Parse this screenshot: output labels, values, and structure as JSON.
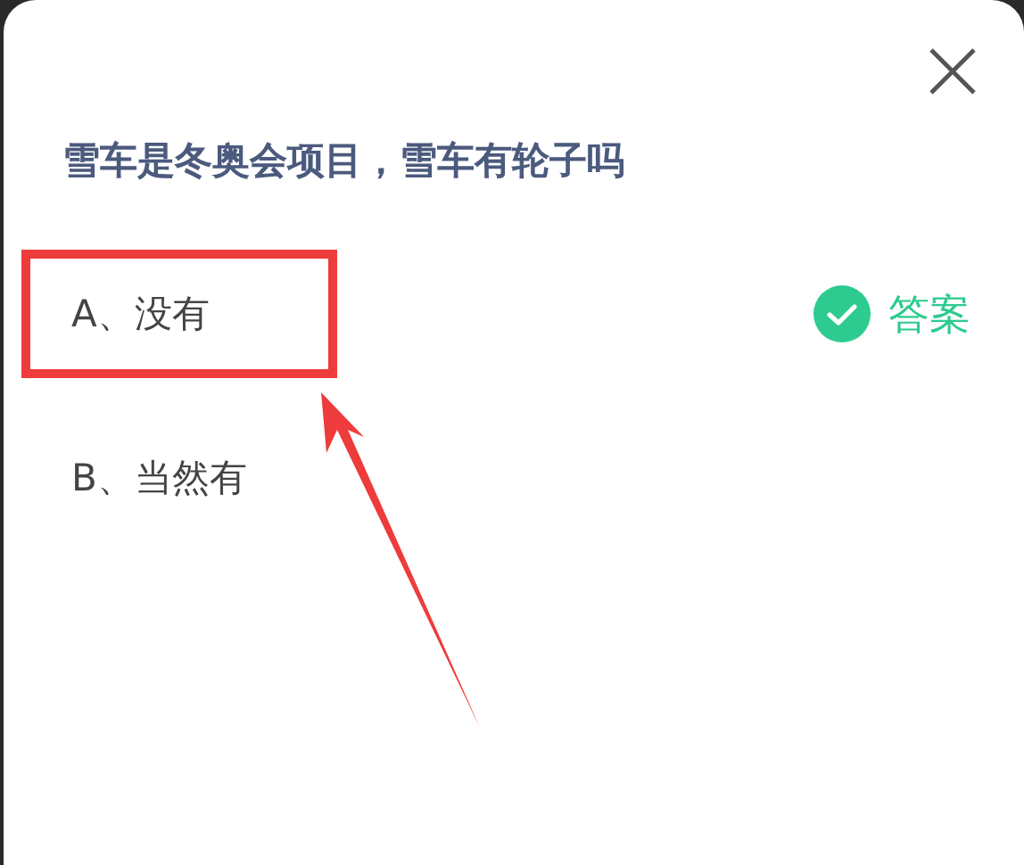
{
  "question": "雪车是冬奥会项目，雪车有轮子吗",
  "options": [
    {
      "label": "A、没有",
      "highlighted": true,
      "correct": true
    },
    {
      "label": "B、当然有",
      "highlighted": false,
      "correct": false
    }
  ],
  "answer_label": "答案"
}
